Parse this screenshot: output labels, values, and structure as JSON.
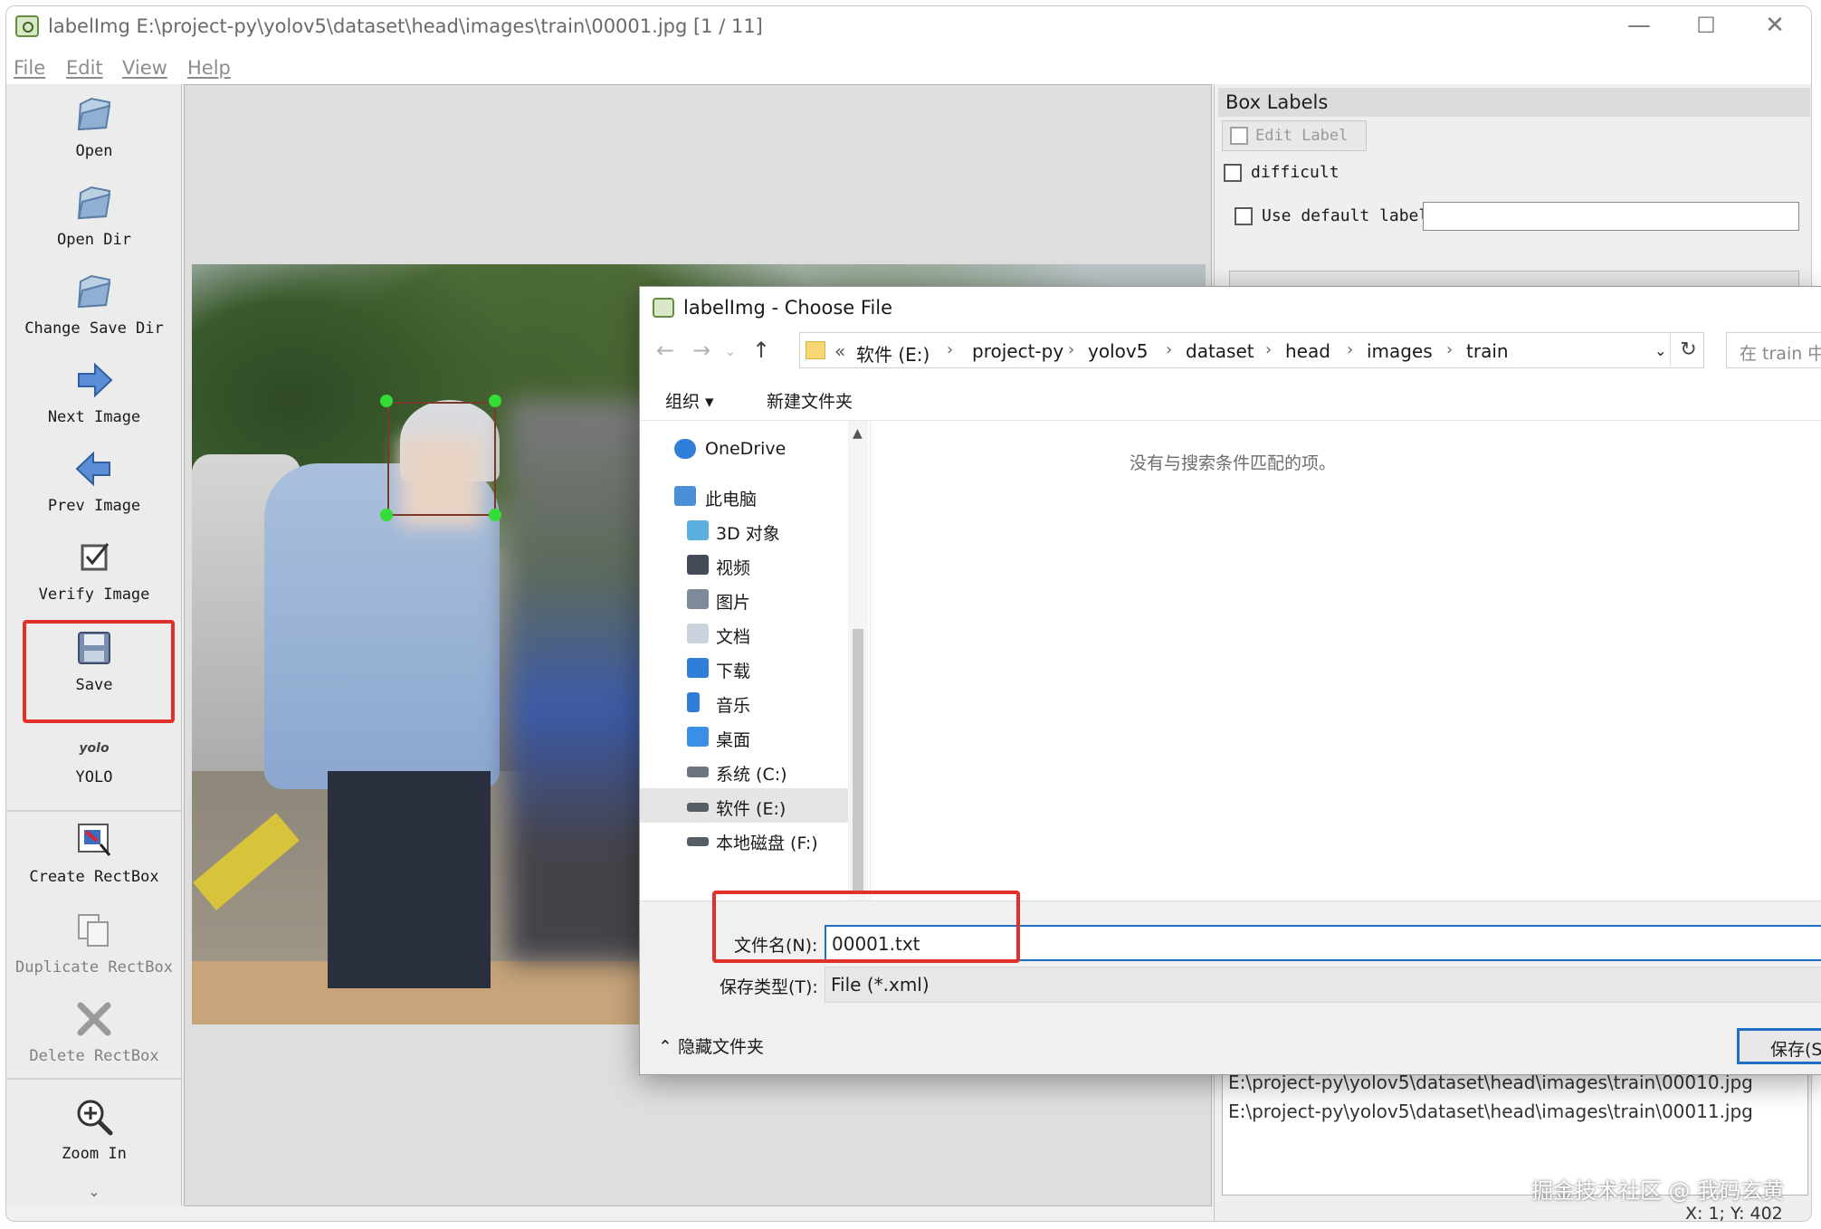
{
  "window": {
    "title": "labelImg E:\\project-py\\yolov5\\dataset\\head\\images\\train\\00001.jpg [1 / 11]",
    "controls": [
      "—",
      "☐",
      "✕"
    ]
  },
  "menu": [
    "File",
    "Edit",
    "View",
    "Help"
  ],
  "toolbar": {
    "items": [
      {
        "label": "Open",
        "icon": "open-folder-icon"
      },
      {
        "label": "Open Dir",
        "icon": "open-folder-icon"
      },
      {
        "label": "Change Save Dir",
        "icon": "open-folder-icon"
      },
      {
        "label": "Next Image",
        "icon": "arrow-right-icon"
      },
      {
        "label": "Prev Image",
        "icon": "arrow-left-icon"
      },
      {
        "label": "Verify Image",
        "icon": "checkbox-icon"
      },
      {
        "label": "Save",
        "icon": "floppy-disk-icon"
      },
      {
        "label": "YOLO",
        "icon": "yolo-format-icon",
        "icon_text": "yolo"
      },
      {
        "label": "Create RectBox",
        "icon": "create-rectbox-icon"
      },
      {
        "label": "Duplicate RectBox",
        "icon": "duplicate-icon"
      },
      {
        "label": "Delete RectBox",
        "icon": "delete-x-icon"
      },
      {
        "label": "Zoom In",
        "icon": "zoom-in-icon"
      }
    ],
    "more": "⌄"
  },
  "box_labels": {
    "header": "Box Labels",
    "edit_label": "Edit Label",
    "difficult": "difficult",
    "use_default_label": "Use default label",
    "default_label_value": ""
  },
  "file_list": [
    "E:\\project-py\\yolov5\\dataset\\head\\images\\train\\00010.jpg",
    "E:\\project-py\\yolov5\\dataset\\head\\images\\train\\00011.jpg"
  ],
  "status": {
    "coords": "X: 1; Y: 402"
  },
  "watermark": "掘金技术社区 @ 我码玄黄",
  "dialog": {
    "title": "labelImg - Choose File",
    "breadcrumb_prefix": "«",
    "breadcrumb": [
      "软件 (E:)",
      "project-py",
      "yolov5",
      "dataset",
      "head",
      "images",
      "train"
    ],
    "search_placeholder": "在 train 中",
    "organize": "组织 ▾",
    "new_folder": "新建文件夹",
    "tree": [
      {
        "label": "OneDrive",
        "color": "#2f7fd8"
      },
      {
        "label": "此电脑",
        "color": "#4a90d9"
      },
      {
        "label": "3D 对象",
        "color": "#5bb0e0"
      },
      {
        "label": "视频",
        "color": "#444c5a"
      },
      {
        "label": "图片",
        "color": "#7c8a99"
      },
      {
        "label": "文档",
        "color": "#c9d3de"
      },
      {
        "label": "下载",
        "color": "#2f7fd8"
      },
      {
        "label": "音乐",
        "color": "#2f7fd8"
      },
      {
        "label": "桌面",
        "color": "#3a8ee6"
      },
      {
        "label": "系统 (C:)",
        "color": "#6a7580"
      },
      {
        "label": "软件 (E:)",
        "color": "#555d66"
      },
      {
        "label": "本地磁盘 (F:)",
        "color": "#555d66"
      }
    ],
    "no_match": "没有与搜索条件匹配的项。",
    "filename_label": "文件名(N):",
    "filename_value": "00001.txt",
    "filetype_label": "保存类型(T):",
    "filetype_value": "File (*.xml)",
    "hide_folders": "隐藏文件夹",
    "save_button": "保存(S)"
  },
  "colors": {
    "highlight_red": "#e0302a",
    "focus_blue": "#1f6fc5",
    "bbox_green": "#33dd33"
  }
}
